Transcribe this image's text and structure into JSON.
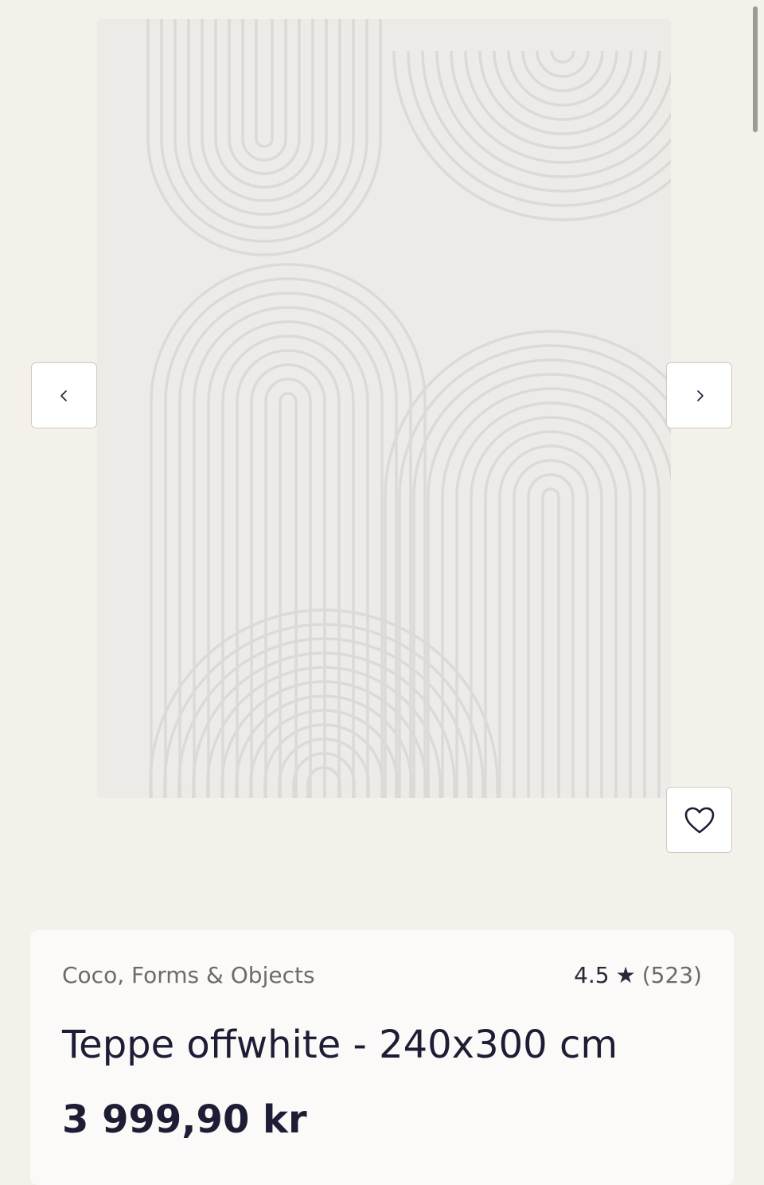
{
  "gallery": {
    "image_alt": "Teppe offwhite",
    "prev_icon": "chevron-left-icon",
    "next_icon": "chevron-right-icon",
    "favorite_icon": "heart-icon"
  },
  "product": {
    "brand": "Coco, Forms & Objects",
    "rating": "4.5",
    "rating_star": "★",
    "review_count": "(523)",
    "title": "Teppe offwhite - 240x300 cm",
    "price": "3 999,90 kr"
  },
  "colors": {
    "background": "#f4f1eb",
    "card": "#fbfaf8",
    "text_dark": "#1f1d35",
    "text_muted": "#6d6b67"
  }
}
